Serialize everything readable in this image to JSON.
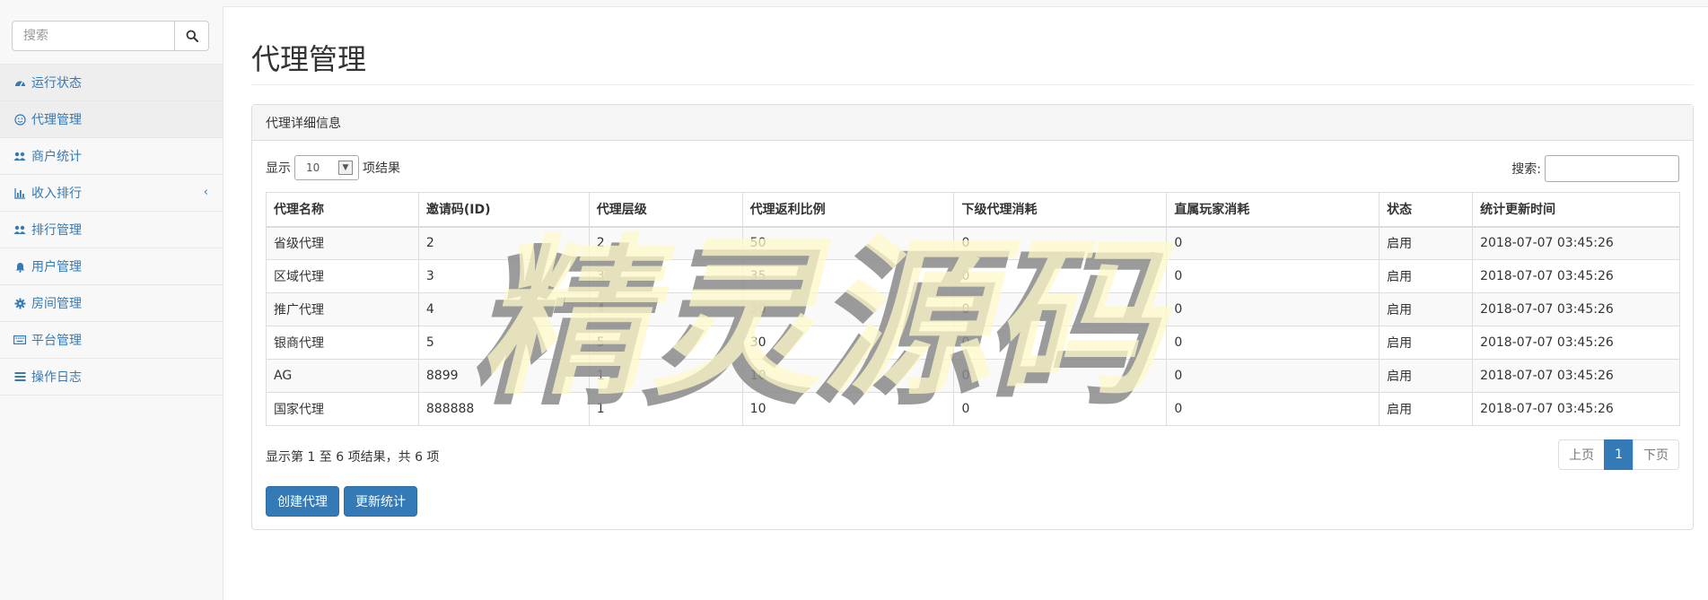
{
  "sidebar": {
    "search": {
      "placeholder": "搜索"
    },
    "items": [
      {
        "label": "运行状态",
        "icon": "dashboard-icon"
      },
      {
        "label": "代理管理",
        "icon": "smile-icon"
      },
      {
        "label": "商户统计",
        "icon": "users-icon"
      },
      {
        "label": "收入排行",
        "icon": "bar-chart-icon"
      },
      {
        "label": "排行管理",
        "icon": "users-icon"
      },
      {
        "label": "用户管理",
        "icon": "bell-icon"
      },
      {
        "label": "房间管理",
        "icon": "gear-icon"
      },
      {
        "label": "平台管理",
        "icon": "keyboard-icon"
      },
      {
        "label": "操作日志",
        "icon": "list-icon"
      }
    ]
  },
  "main": {
    "title": "代理管理",
    "panel_title": "代理详细信息",
    "length": {
      "prefix": "显示",
      "value": "10",
      "suffix": "项结果"
    },
    "filter_label": "搜索:",
    "columns": [
      "代理名称",
      "邀请码(ID)",
      "代理层级",
      "代理返利比例",
      "下级代理消耗",
      "直属玩家消耗",
      "状态",
      "统计更新时间"
    ],
    "rows": [
      [
        "省级代理",
        "2",
        "2",
        "50",
        "0",
        "0",
        "启用",
        "2018-07-07 03:45:26"
      ],
      [
        "区域代理",
        "3",
        "3",
        "35",
        "0",
        "0",
        "启用",
        "2018-07-07 03:45:26"
      ],
      [
        "推广代理",
        "4",
        "4",
        "30",
        "0",
        "0",
        "启用",
        "2018-07-07 03:45:26"
      ],
      [
        "银商代理",
        "5",
        "5",
        "30",
        "0",
        "0",
        "启用",
        "2018-07-07 03:45:26"
      ],
      [
        "AG",
        "8899",
        "1",
        "10",
        "0",
        "0",
        "启用",
        "2018-07-07 03:45:26"
      ],
      [
        "国家代理",
        "888888",
        "1",
        "10",
        "0",
        "0",
        "启用",
        "2018-07-07 03:45:26"
      ]
    ],
    "info": "显示第 1 至 6 项结果，共 6 项",
    "pager": {
      "prev": "上页",
      "current": "1",
      "next": "下页"
    },
    "buttons": {
      "create": "创建代理",
      "refresh": "更新统计"
    },
    "watermark": "精灵源码"
  },
  "colors": {
    "link": "#337ab7",
    "primary": "#337ab7",
    "watermark_fill": "#fff8c8",
    "watermark_shadow": "#8a8a8a"
  }
}
